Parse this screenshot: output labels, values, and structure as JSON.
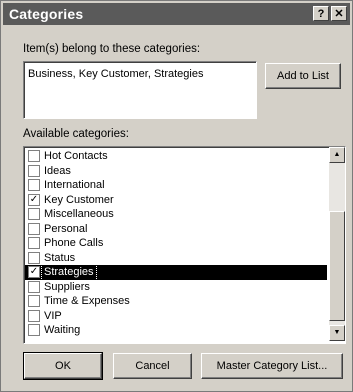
{
  "dialog": {
    "title": "Categories",
    "help_glyph": "?",
    "close_glyph": "✕"
  },
  "assigned": {
    "label": "Item(s) belong to these categories:",
    "value": "Business, Key Customer, Strategies"
  },
  "add_to_list_label": "Add to List",
  "available_label": "Available categories:",
  "categories": [
    {
      "label": "Hot Contacts",
      "checked": false,
      "selected": false
    },
    {
      "label": "Ideas",
      "checked": false,
      "selected": false
    },
    {
      "label": "International",
      "checked": false,
      "selected": false
    },
    {
      "label": "Key Customer",
      "checked": true,
      "selected": false
    },
    {
      "label": "Miscellaneous",
      "checked": false,
      "selected": false
    },
    {
      "label": "Personal",
      "checked": false,
      "selected": false
    },
    {
      "label": "Phone Calls",
      "checked": false,
      "selected": false
    },
    {
      "label": "Status",
      "checked": false,
      "selected": false
    },
    {
      "label": "Strategies",
      "checked": true,
      "selected": true
    },
    {
      "label": "Suppliers",
      "checked": false,
      "selected": false
    },
    {
      "label": "Time & Expenses",
      "checked": false,
      "selected": false
    },
    {
      "label": "VIP",
      "checked": false,
      "selected": false
    },
    {
      "label": "Waiting",
      "checked": false,
      "selected": false
    }
  ],
  "scroll_up_glyph": "▲",
  "scroll_down_glyph": "▼",
  "check_glyph": "✓",
  "buttons": {
    "ok": "OK",
    "cancel": "Cancel",
    "master": "Master Category List..."
  }
}
